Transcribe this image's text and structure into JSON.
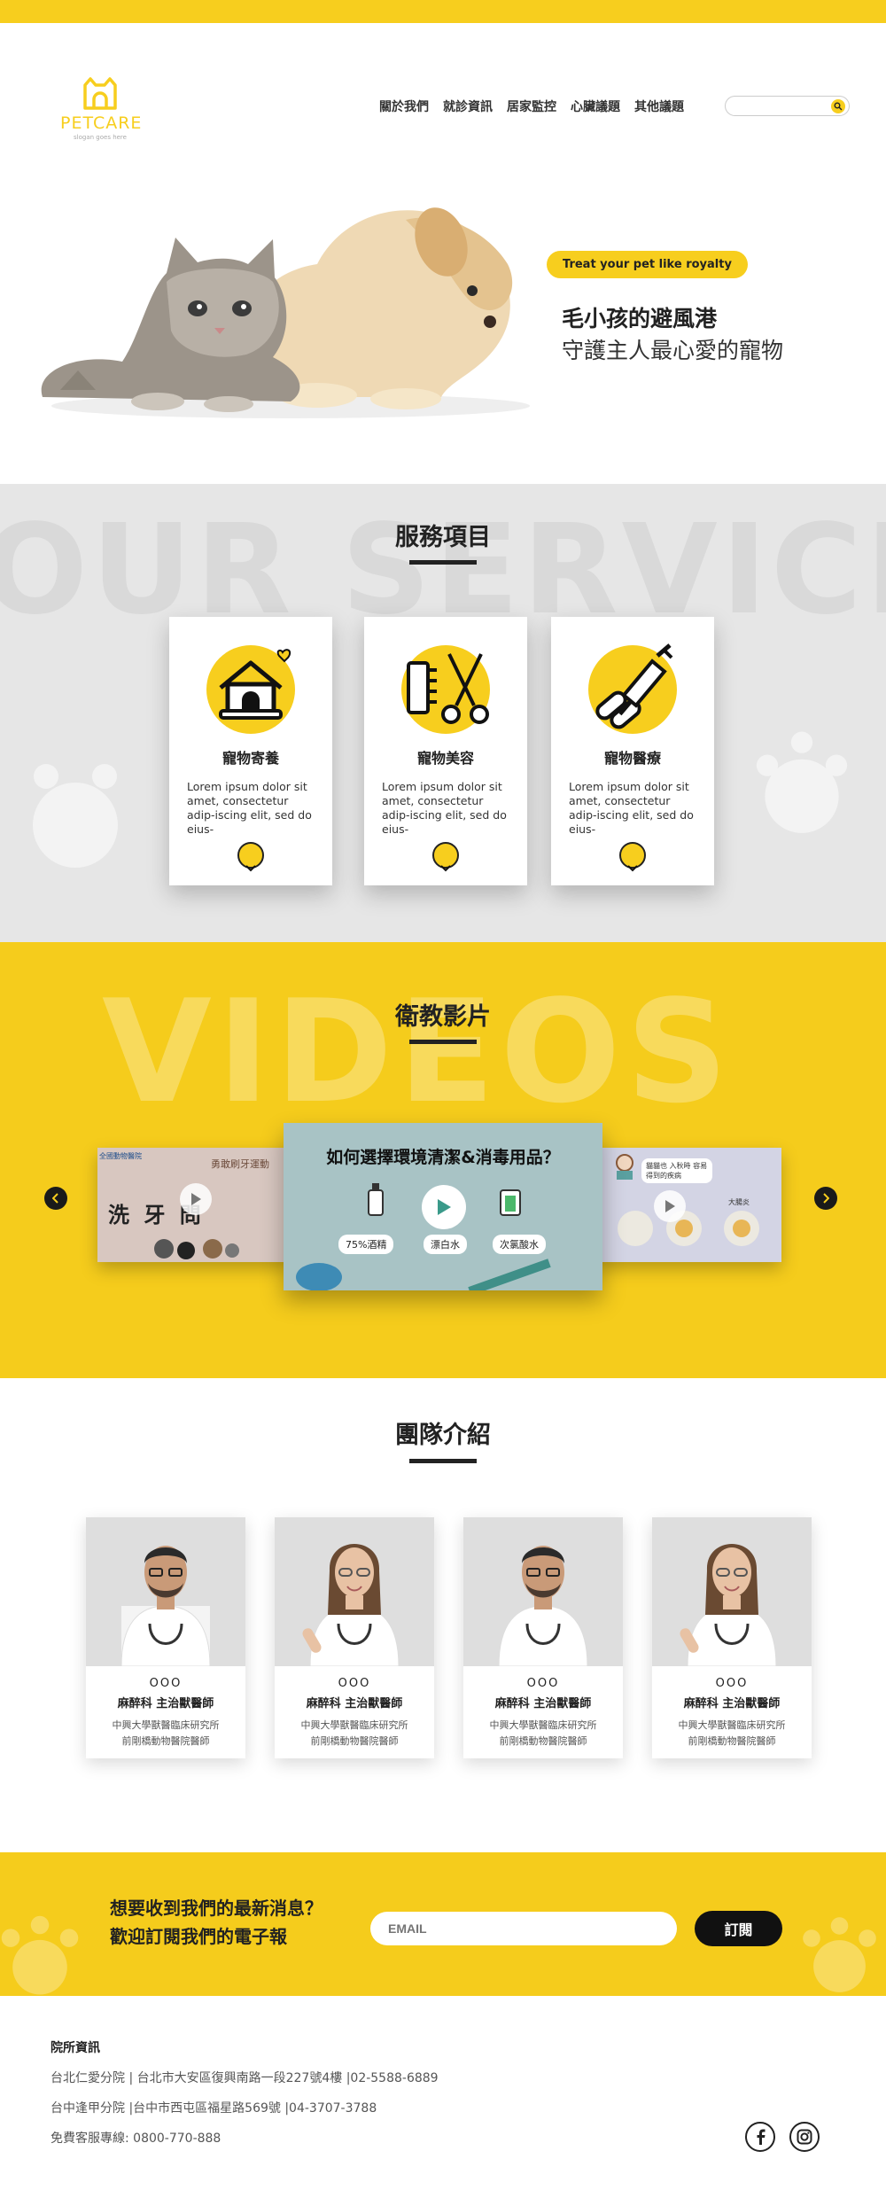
{
  "brand": {
    "name": "PETCARE",
    "slogan": "slogan goes here",
    "accent": "#F7CE1E"
  },
  "nav": {
    "items": [
      "關於我們",
      "就診資訊",
      "居家監控",
      "心臟議題",
      "其他議題"
    ],
    "search_placeholder": ""
  },
  "hero": {
    "tag": "Treat your pet like royalty",
    "title": "毛小孩的避風港",
    "subtitle": "守護主人最心愛的寵物"
  },
  "services": {
    "bg_word": "OUR SERVICES",
    "title": "服務項目",
    "cards": [
      {
        "icon": "pet-house-icon",
        "title": "寵物寄養",
        "text": "Lorem ipsum dolor sit amet, consectetur adip-iscing elit, sed do eius-"
      },
      {
        "icon": "grooming-icon",
        "title": "寵物美容",
        "text": "Lorem ipsum dolor sit amet, consectetur adip-iscing elit, sed do eius-"
      },
      {
        "icon": "medicine-icon",
        "title": "寵物醫療",
        "text": "Lorem ipsum dolor sit amet, consectetur adip-iscing elit, sed do eius-"
      }
    ]
  },
  "videos": {
    "bg_word": "VIDEOS",
    "title": "衛教影片",
    "left": {
      "channel": "全國動物醫院",
      "tag": "勇敢刷牙運動",
      "title": "洗 牙  問"
    },
    "center": {
      "title": "如何選擇環境清潔&消毒用品？",
      "items": [
        "75%酒精",
        "漂白水",
        "次氯酸水"
      ]
    },
    "right": {
      "bubble": "貓貓也 入秋時 容易得到的疾病",
      "label": "大腸炎"
    }
  },
  "team": {
    "title": "團隊介紹",
    "members": [
      {
        "name": "OOO",
        "role": "麻醉科 主治獸醫師",
        "desc1": "中興大學獸醫臨床研究所",
        "desc2": "前剛橋動物醫院醫師"
      },
      {
        "name": "OOO",
        "role": "麻醉科 主治獸醫師",
        "desc1": "中興大學獸醫臨床研究所",
        "desc2": "前剛橋動物醫院醫師"
      },
      {
        "name": "OOO",
        "role": "麻醉科 主治獸醫師",
        "desc1": "中興大學獸醫臨床研究所",
        "desc2": "前剛橋動物醫院醫師"
      },
      {
        "name": "OOO",
        "role": "麻醉科 主治獸醫師",
        "desc1": "中興大學獸醫臨床研究所",
        "desc2": "前剛橋動物醫院醫師"
      }
    ]
  },
  "newsletter": {
    "line1": "想要收到我們的最新消息？",
    "line2": "歡迎訂閱我們的電子報",
    "email_placeholder": "EMAIL",
    "button": "訂閱"
  },
  "footer": {
    "title": "院所資訊",
    "lines": [
      "台北仁愛分院 | 台北市大安區復興南路一段227號4樓 |02-5588-6889",
      "台中逢甲分院 |台中市西屯區福星路569號 |04-3707-3788",
      "免費客服專線: 0800-770-888"
    ]
  }
}
